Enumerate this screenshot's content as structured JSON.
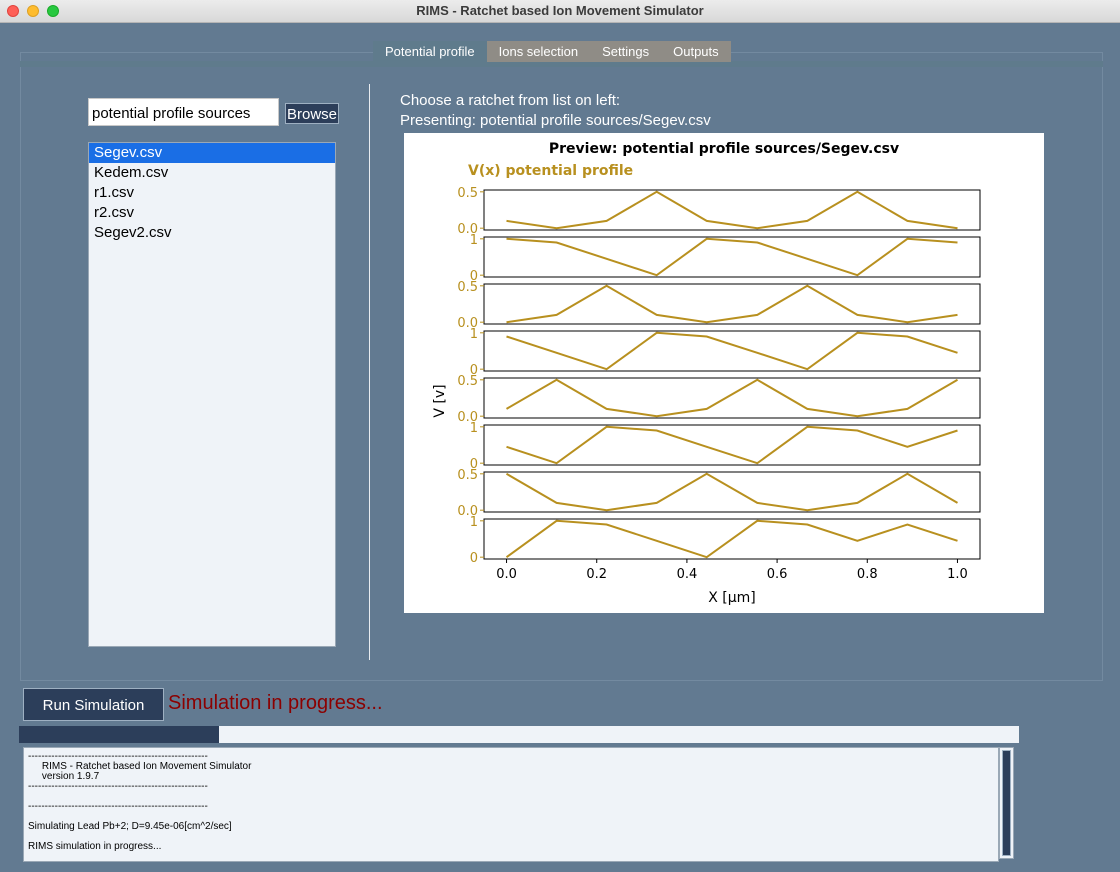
{
  "window": {
    "title": "RIMS - Ratchet based Ion Movement Simulator"
  },
  "tabs": [
    {
      "label": "Potential profile",
      "active": true
    },
    {
      "label": "Ions selection"
    },
    {
      "label": "Settings"
    },
    {
      "label": "Outputs"
    }
  ],
  "left_panel": {
    "path_value": "potential profile sources",
    "browse_label": "Browse",
    "files": [
      "Segev.csv",
      "Kedem.csv",
      "r1.csv",
      "r2.csv",
      "Segev2.csv"
    ],
    "selected": "Segev.csv"
  },
  "right_panel": {
    "instruction": "Choose a ratchet from list on left:",
    "presenting": "Presenting: potential profile sources/Segev.csv"
  },
  "chart_data": {
    "type": "line",
    "title": "Preview: potential profile sources/Segev.csv",
    "subtitle": "V(x) potential profile",
    "xlabel": "X [μm]",
    "ylabel": "V [v]",
    "xlim": [
      -0.05,
      1.05
    ],
    "x_ticks": [
      "0.0",
      "0.2",
      "0.4",
      "0.6",
      "0.8",
      "1.0"
    ],
    "color": "#b8901f",
    "x": [
      0,
      0.111,
      0.222,
      0.333,
      0.444,
      0.556,
      0.667,
      0.778,
      0.889,
      1.0
    ],
    "series": [
      {
        "values": [
          0.1,
          0.0,
          0.1,
          0.5,
          0.1,
          0.0,
          0.1,
          0.5,
          0.1,
          0.0
        ],
        "ylim": [
          0,
          0.5
        ],
        "yticks": [
          "0.5",
          "0.0"
        ]
      },
      {
        "values": [
          1.0,
          0.9,
          0.45,
          0.0,
          1.0,
          0.9,
          0.45,
          0.0,
          1.0,
          0.9
        ],
        "ylim": [
          0,
          1
        ],
        "yticks": [
          "1",
          "0"
        ]
      },
      {
        "values": [
          0.0,
          0.1,
          0.5,
          0.1,
          0.0,
          0.1,
          0.5,
          0.1,
          0.0,
          0.1
        ],
        "ylim": [
          0,
          0.5
        ],
        "yticks": [
          "0.5",
          "0.0"
        ]
      },
      {
        "values": [
          0.9,
          0.45,
          0.0,
          1.0,
          0.9,
          0.45,
          0.0,
          1.0,
          0.9,
          0.45
        ],
        "ylim": [
          0,
          1
        ],
        "yticks": [
          "1",
          "0"
        ]
      },
      {
        "values": [
          0.1,
          0.5,
          0.1,
          0.0,
          0.1,
          0.5,
          0.1,
          0.0,
          0.1,
          0.5
        ],
        "ylim": [
          0,
          0.5
        ],
        "yticks": [
          "0.5",
          "0.0"
        ]
      },
      {
        "values": [
          0.45,
          0.0,
          1.0,
          0.9,
          0.45,
          0.0,
          1.0,
          0.9,
          0.45,
          0.9
        ],
        "ylim": [
          0,
          1
        ],
        "yticks": [
          "1",
          "0"
        ]
      },
      {
        "values": [
          0.5,
          0.1,
          0.0,
          0.1,
          0.5,
          0.1,
          0.0,
          0.1,
          0.5,
          0.1
        ],
        "ylim": [
          0,
          0.5
        ],
        "yticks": [
          "0.5",
          "0.0"
        ]
      },
      {
        "values": [
          0.0,
          1.0,
          0.9,
          0.45,
          0.0,
          1.0,
          0.9,
          0.45,
          0.9,
          0.45
        ],
        "ylim": [
          0,
          1
        ],
        "yticks": [
          "1",
          "0"
        ]
      }
    ]
  },
  "run": {
    "button_label": "Run Simulation",
    "status_text": "Simulation in progress...",
    "status_color": "#8b0000",
    "progress": 0.2
  },
  "log": {
    "lines": [
      "------------------------------------------------------",
      "     RIMS - Ratchet based Ion Movement Simulator",
      "     version 1.9.7",
      "------------------------------------------------------",
      "",
      "------------------------------------------------------",
      "",
      "Simulating Lead Pb+2; D=9.45e-06[cm^2/sec]",
      "",
      "RIMS simulation in progress..."
    ]
  }
}
